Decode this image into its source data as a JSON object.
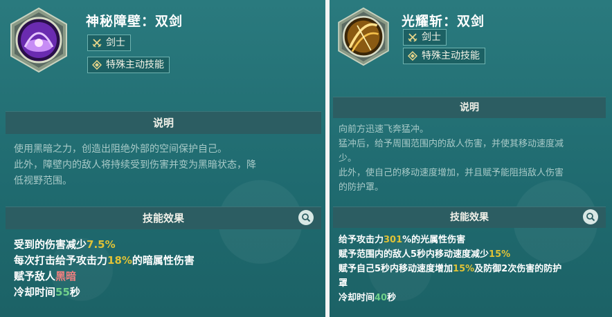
{
  "left": {
    "title": "神秘障壁：双剑",
    "tag_class": "剑士",
    "tag_type": "特殊主动技能",
    "section_desc": "说明",
    "desc_lines": [
      "使用黑暗之力，创造出阻绝外部的空间保护自己。",
      "此外，障壁内的敌人将持续受到伤害并变为黑暗状态，降",
      "低视野范围。"
    ],
    "section_effects": "技能效果",
    "eff1_pre": "受到的伤害减少",
    "eff1_val": "7.5%",
    "eff2_pre": "每次打击给予攻击力",
    "eff2_val": "18%",
    "eff2_post": "的暗属性伤害",
    "eff3_pre": "赋予敌人",
    "eff3_val": "黑暗",
    "eff4_pre": "冷却时间",
    "eff4_val": "55",
    "eff4_post": "秒"
  },
  "right": {
    "title": "光耀斩：双剑",
    "tag_class": "剑士",
    "tag_type": "特殊主动技能",
    "section_desc": "说明",
    "desc_lines": [
      "向前方迅速飞奔猛冲。",
      "猛冲后，给予周围范围内的敌人伤害，并使其移动速度减",
      "少。",
      "此外，使自己的移动速度增加，并且赋予能阻挡敌人伤害",
      "的防护罩。"
    ],
    "section_effects": "技能效果",
    "eff1_pre": "给予攻击力",
    "eff1_val": "301",
    "eff1_post": "%的光属性伤害",
    "eff2_pre": "赋予范围内的敌人5秒内移动速度减少",
    "eff2_val": "15%",
    "eff3_pre": "赋予自己5秒内移动速度增加",
    "eff3_val": "15%",
    "eff3_post": "及防御2次伤害的防护",
    "eff3_line2": "罩",
    "eff4_pre": "冷却时间",
    "eff4_val": "40",
    "eff4_post": "秒"
  },
  "colors": {
    "panel": "#1f6b70",
    "highlight_yellow": "#e0c236",
    "highlight_green": "#6fd08a",
    "highlight_red": "#f08080"
  },
  "icons": [
    "crossed-swords-icon",
    "diamond-skill-icon",
    "search-icon",
    "purple-barrier-emblem",
    "golden-slash-emblem"
  ]
}
